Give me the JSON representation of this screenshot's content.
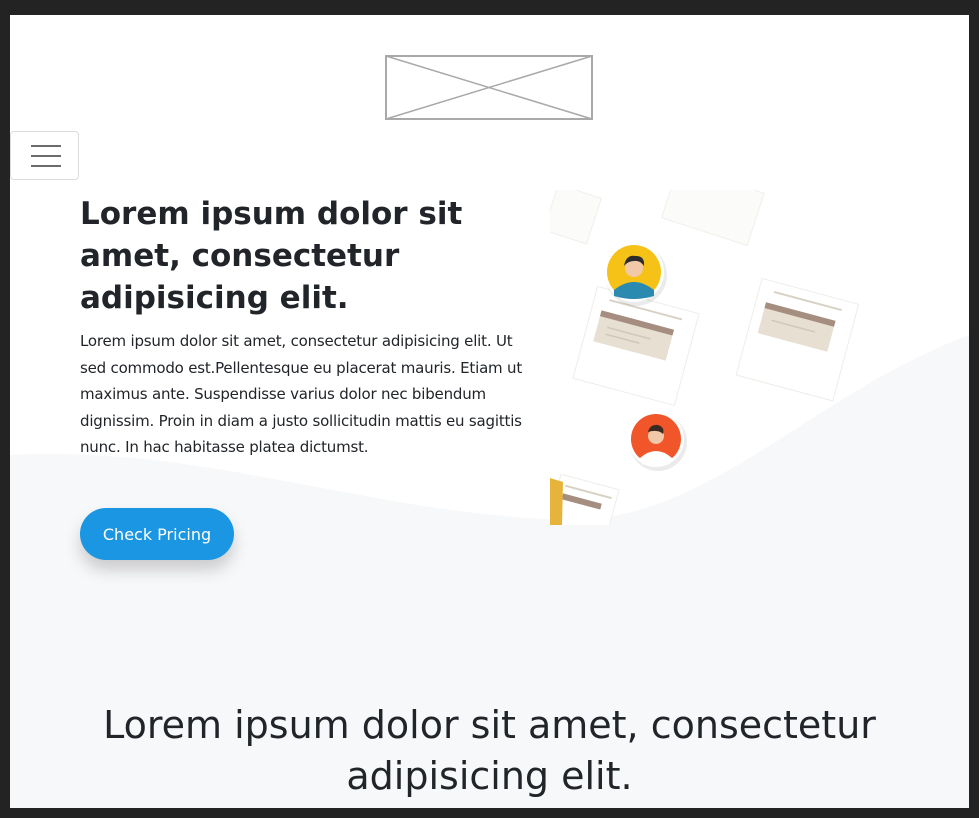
{
  "header": {
    "logo": "logo-placeholder",
    "menu_icon": "hamburger-icon"
  },
  "hero": {
    "title": "Lorem ipsum dolor sit amet, consectetur adipisicing elit.",
    "text": "Lorem ipsum dolor sit amet, consectetur adipisicing elit. Ut sed commodo est.Pellentesque eu placerat mauris. Etiam ut maximus ante. Suspendisse varius dolor nec bibendum dignissim. Proin in diam a justo sollicitudin mattis eu sagittis nunc. In hac habitasse platea dictumst.",
    "cta_label": "Check Pricing",
    "illustration": "team-documents-illustration"
  },
  "section": {
    "title": "Lorem ipsum dolor sit amet, consectetur adipisicing elit."
  },
  "colors": {
    "accent": "#1a96e3",
    "text": "#212529",
    "wave": "#f7f8fa",
    "frame": "#232323"
  }
}
